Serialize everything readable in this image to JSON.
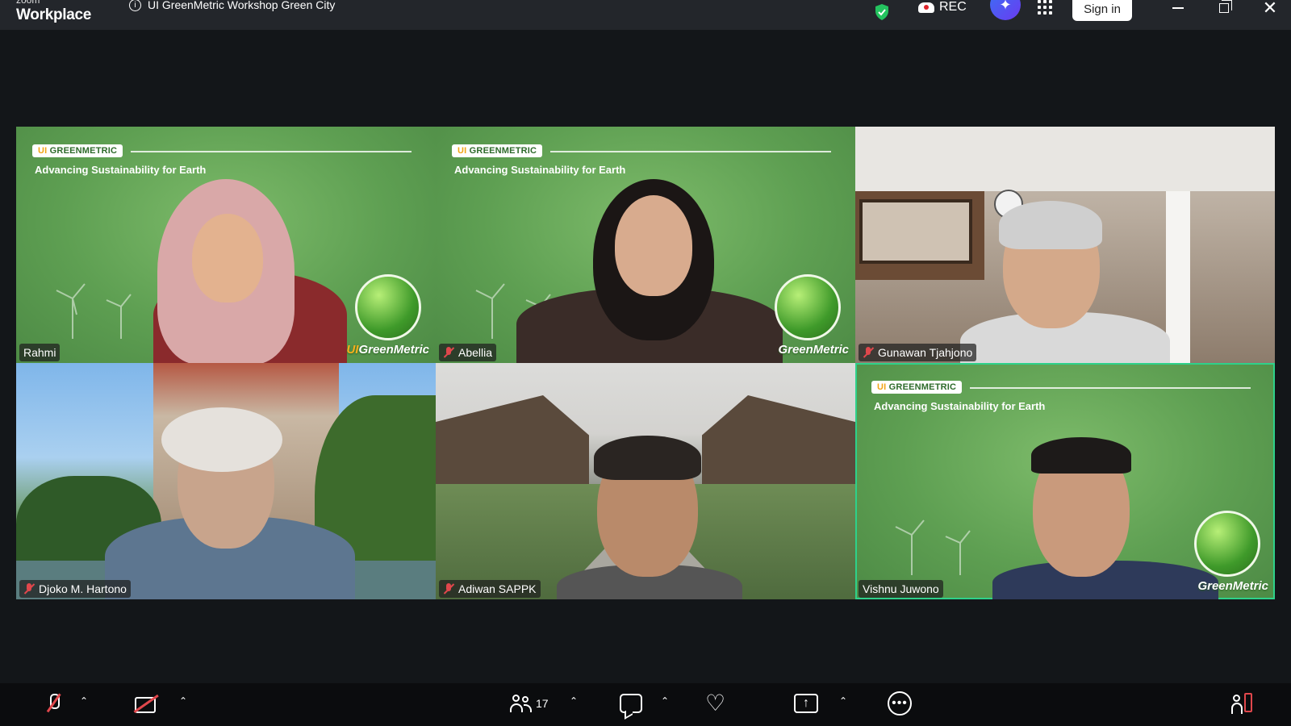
{
  "app": {
    "brand_small": "zoom",
    "brand_main": "Workplace",
    "meeting_title": "UI GreenMetric Workshop Green City"
  },
  "titlebar": {
    "rec_label": "REC",
    "sign_in_label": "Sign in"
  },
  "backdrop": {
    "pill_prefix": "UI",
    "pill_text": "GREENMETRIC",
    "tagline": "Advancing Sustainability for Earth",
    "brand_prefix": "UI",
    "brand_text": "GreenMetric"
  },
  "participants": [
    {
      "name": "Rahmi",
      "muted": false,
      "background": "greenmetric"
    },
    {
      "name": "Abellia",
      "muted": true,
      "background": "greenmetric"
    },
    {
      "name": "Gunawan Tjahjono",
      "muted": true,
      "background": "office"
    },
    {
      "name": "Djoko M. Hartono",
      "muted": true,
      "background": "campus"
    },
    {
      "name": "Adiwan SAPPK",
      "muted": true,
      "background": "building"
    },
    {
      "name": "Vishnu Juwono",
      "muted": false,
      "background": "greenmetric",
      "active_speaker": true
    }
  ],
  "toolbar": {
    "participant_count": "17"
  },
  "colors": {
    "active_border": "#2ed18a",
    "mute_red": "#e0474c",
    "rec_red": "#e0242b",
    "shield_green": "#24c35f"
  }
}
